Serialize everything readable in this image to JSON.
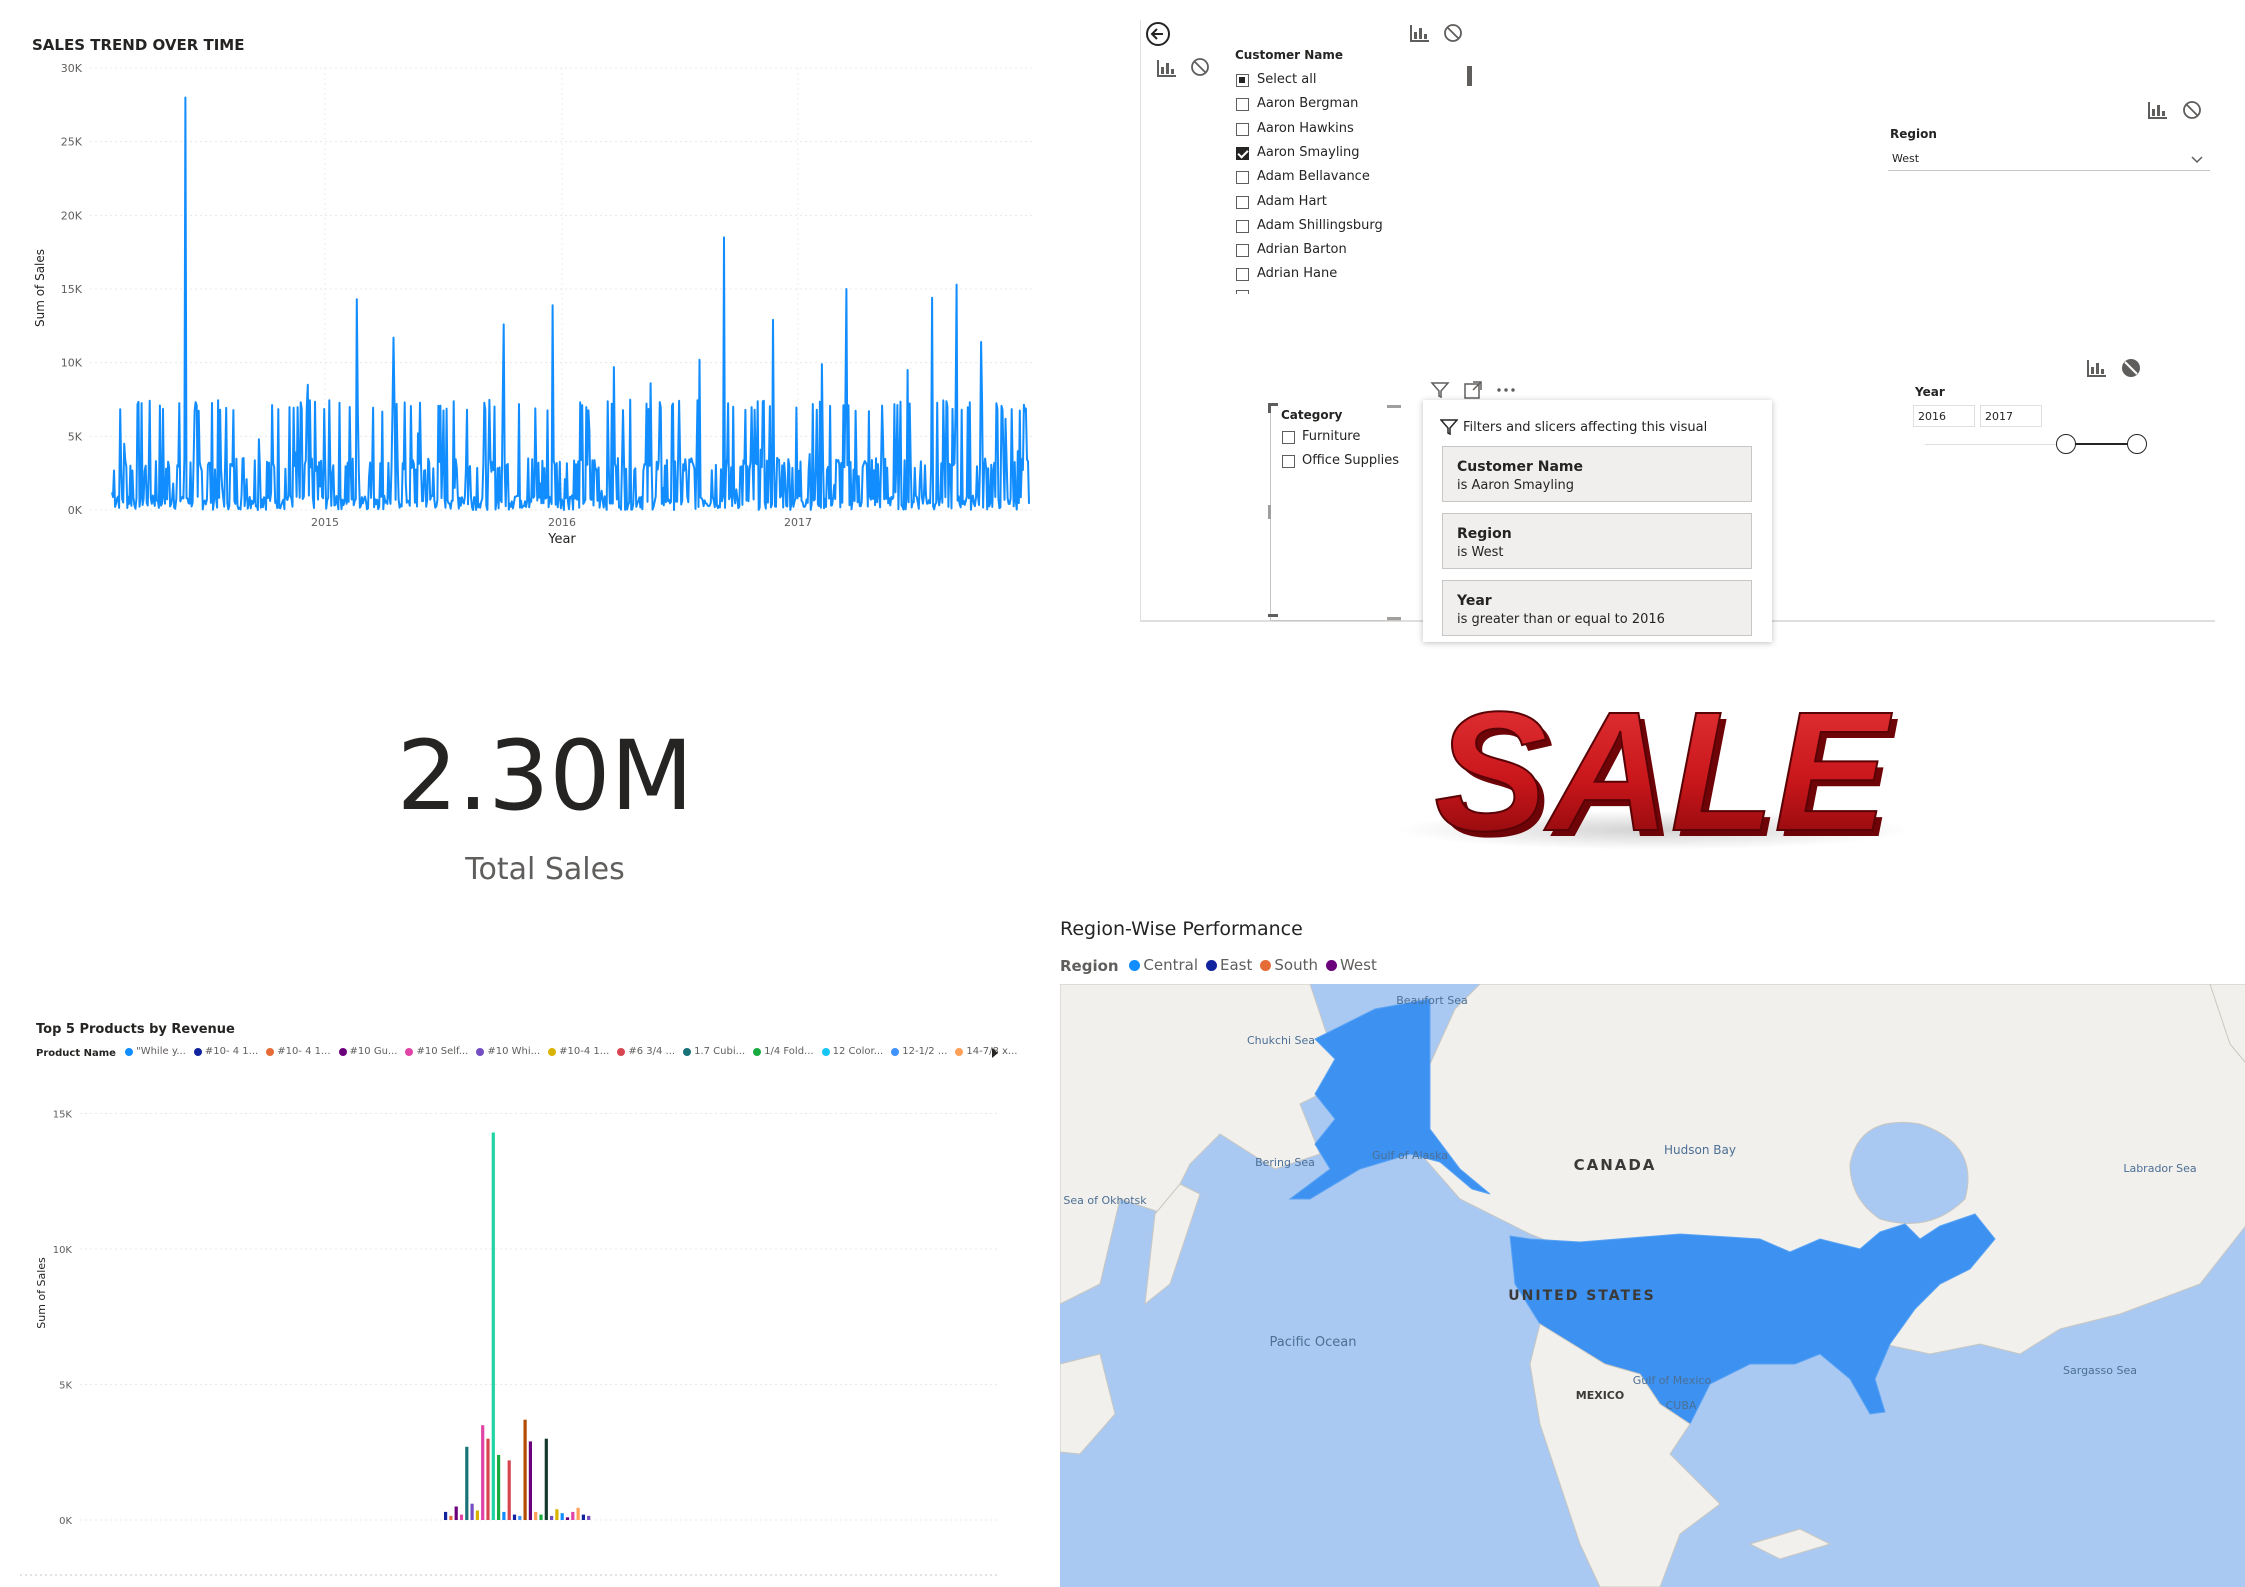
{
  "sales_trend": {
    "title": "SALES TREND OVER TIME",
    "ylabel": "Sum of Sales",
    "xlabel": "Year",
    "yticks": [
      "30K",
      "25K",
      "20K",
      "15K",
      "10K",
      "5K",
      "0K"
    ],
    "xticks": [
      "2015",
      "2016",
      "2017"
    ],
    "color": "#118dff"
  },
  "customer_slicer": {
    "header": "Customer Name",
    "items": [
      {
        "label": "Select all",
        "state": "partial"
      },
      {
        "label": "Aaron Bergman",
        "state": "off"
      },
      {
        "label": "Aaron Hawkins",
        "state": "off"
      },
      {
        "label": "Aaron Smayling",
        "state": "on"
      },
      {
        "label": "Adam Bellavance",
        "state": "off"
      },
      {
        "label": "Adam Hart",
        "state": "off"
      },
      {
        "label": "Adam Shillingsburg",
        "state": "off"
      },
      {
        "label": "Adrian Barton",
        "state": "off"
      },
      {
        "label": "Adrian Hane",
        "state": "off"
      }
    ]
  },
  "region_slicer": {
    "header": "Region",
    "value": "West"
  },
  "category_slicer": {
    "header": "Category",
    "items": [
      {
        "label": "Furniture"
      },
      {
        "label": "Office Supplies"
      }
    ]
  },
  "year_slicer": {
    "header": "Year",
    "from": "2016",
    "to": "2017"
  },
  "filters_popup": {
    "title": "Filters and slicers affecting this visual",
    "cards": [
      {
        "field": "Customer Name",
        "condition": "is Aaron Smayling"
      },
      {
        "field": "Region",
        "condition": "is West"
      },
      {
        "field": "Year",
        "condition": "is greater than or equal to 2016"
      }
    ]
  },
  "kpi": {
    "value": "2.30M",
    "label": "Total Sales"
  },
  "sale_image": {
    "text": "SALE"
  },
  "top_products": {
    "title": "Top 5 Products by Revenue",
    "legend_title": "Product Name",
    "legend": [
      {
        "label": "\"While y...",
        "color": "#118dff"
      },
      {
        "label": "#10- 4 1...",
        "color": "#12239e"
      },
      {
        "label": "#10- 4 1...",
        "color": "#e66c37"
      },
      {
        "label": "#10 Gu...",
        "color": "#6b007b"
      },
      {
        "label": "#10 Self...",
        "color": "#e044a7"
      },
      {
        "label": "#10 Whi...",
        "color": "#744ec2"
      },
      {
        "label": "#10-4 1...",
        "color": "#d9b300"
      },
      {
        "label": "#6 3/4 ...",
        "color": "#d64550"
      },
      {
        "label": "1.7 Cubi...",
        "color": "#197278"
      },
      {
        "label": "1/4 Fold...",
        "color": "#1aab40"
      },
      {
        "label": "12 Color...",
        "color": "#15c6f4"
      },
      {
        "label": "12-1/2 ...",
        "color": "#4092ff"
      },
      {
        "label": "14-7/8 x...",
        "color": "#ffa058"
      }
    ],
    "ylabel": "Sum of Sales",
    "yticks": [
      "15K",
      "10K",
      "5K",
      "0K"
    ]
  },
  "chart_data": [
    {
      "type": "line",
      "title": "SALES TREND OVER TIME",
      "xlabel": "Year",
      "ylabel": "Sum of Sales",
      "ylim": [
        0,
        30000
      ],
      "x_ticks": [
        "2015",
        "2016",
        "2017"
      ],
      "series": [
        {
          "values": [
            1200,
            4500,
            800,
            2600,
            300,
            1800,
            28000,
            900,
            3200,
            1500,
            600,
            2100,
            4800,
            1200,
            700,
            3900,
            8500,
            1600,
            2400,
            600,
            14300,
            2200,
            900,
            11700,
            1800,
            5200,
            700,
            3100,
            1500,
            6800,
            400,
            2600,
            12600,
            900,
            3500,
            1800,
            13900,
            2100,
            700,
            5400,
            1300,
            9700,
            2800,
            600,
            8600,
            1500,
            3300,
            900,
            10200,
            2700,
            18500,
            1400,
            600,
            4100,
            12900,
            2200,
            800,
            3800,
            9900,
            1700,
            15000,
            2300,
            700,
            4600,
            1200,
            9500,
            2100,
            14400,
            3800,
            15300,
            800,
            11400,
            2600,
            6200,
            4000,
            1500
          ]
        }
      ]
    },
    {
      "type": "bar",
      "title": "Top 5 Products by Revenue",
      "ylabel": "Sum of Sales",
      "ylim": [
        0,
        15000
      ],
      "values": [
        300,
        150,
        500,
        200,
        2700,
        600,
        350,
        3500,
        3000,
        14300,
        2400,
        300,
        2200,
        200,
        150,
        3700,
        2900,
        300,
        200,
        3000,
        150,
        400,
        250,
        100,
        300,
        450,
        200,
        150
      ]
    }
  ],
  "region_map": {
    "title": "Region-Wise Performance",
    "legend_title": "Region",
    "legend": [
      {
        "label": "Central",
        "color": "#118dff"
      },
      {
        "label": "East",
        "color": "#12239e"
      },
      {
        "label": "South",
        "color": "#e66c37"
      },
      {
        "label": "West",
        "color": "#6b007b"
      }
    ],
    "labels": [
      "Beaufort Sea",
      "Chukchi Sea",
      "Bering Sea",
      "Gulf of Alaska",
      "Sea of Okhotsk",
      "CANADA",
      "Hudson Bay",
      "Labrador Sea",
      "UNITED STATES",
      "Pacific Ocean",
      "Sargasso Sea",
      "Gulf of Mexico",
      "MEXICO",
      "CUBA"
    ]
  }
}
